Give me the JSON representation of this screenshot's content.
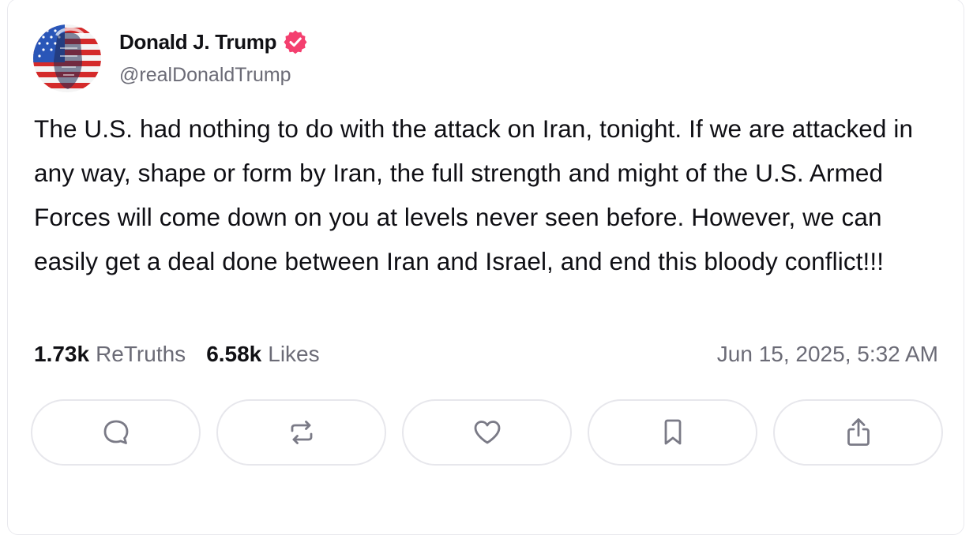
{
  "post": {
    "author": {
      "display_name": "Donald J. Trump",
      "handle": "@realDonaldTrump",
      "verified_icon": "verified-badge-icon",
      "avatar_icon": "avatar-flag-portrait"
    },
    "text": "The U.S. had nothing to do with the attack on Iran, tonight. If we are attacked in any way, shape or form by Iran, the full strength and might of the U.S. Armed Forces will come down on you at levels never seen before. However, we can easily get a deal done between Iran and Israel, and end this bloody conflict!!!",
    "stats": {
      "retruths_count": "1.73k",
      "retruths_label": "ReTruths",
      "likes_count": "6.58k",
      "likes_label": "Likes"
    },
    "timestamp": "Jun 15, 2025, 5:32 AM",
    "actions": [
      {
        "name": "reply",
        "icon": "comment-icon"
      },
      {
        "name": "retruth",
        "icon": "repost-icon"
      },
      {
        "name": "like",
        "icon": "heart-icon"
      },
      {
        "name": "bookmark",
        "icon": "bookmark-icon"
      },
      {
        "name": "share",
        "icon": "share-icon"
      }
    ]
  },
  "colors": {
    "text_primary": "#0f0f14",
    "text_secondary": "#6b6b76",
    "verified_badge": "#f43f6f",
    "button_border": "#e7e7ec",
    "icon_color": "#7a7a86"
  }
}
